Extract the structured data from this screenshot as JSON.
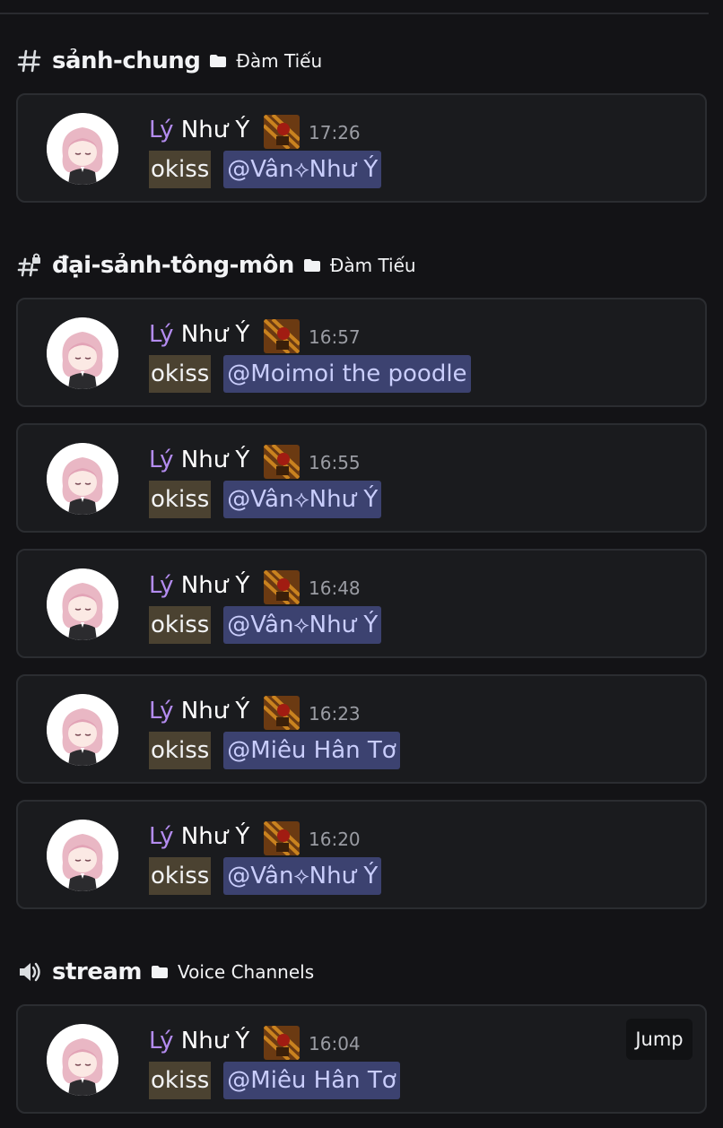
{
  "channels": {
    "sanh_chung": {
      "name": "sảnh-chung",
      "category": "Đàm Tiếu"
    },
    "dai_sanh": {
      "name": "đại-sảnh-tông-môn",
      "category": "Đàm Tiếu"
    },
    "stream": {
      "name": "stream",
      "category": "Voice Channels"
    }
  },
  "author": {
    "name_part1": "Lý",
    "name_part2": " Như Ý"
  },
  "messages": [
    {
      "time": "17:26",
      "text": "okiss",
      "mention": "@Vân⟡Như Ý"
    },
    {
      "time": "16:57",
      "text": "okiss",
      "mention": "@Moimoi the poodle"
    },
    {
      "time": "16:55",
      "text": "okiss",
      "mention": "@Vân⟡Như Ý"
    },
    {
      "time": "16:48",
      "text": "okiss",
      "mention": "@Vân⟡Như Ý"
    },
    {
      "time": "16:23",
      "text": "okiss",
      "mention": "@Miêu Hân Tơ"
    },
    {
      "time": "16:20",
      "text": "okiss",
      "mention": "@Vân⟡Như Ý"
    },
    {
      "time": "16:04",
      "text": "okiss",
      "mention": "@Miêu Hân Tơ"
    }
  ],
  "jump_label": "Jump",
  "colors": {
    "background": "#131316",
    "card": "#1a1b1e",
    "username_accent": "#b48cf0",
    "mention_bg": "#3c4270",
    "mention_text": "#c9cdfb",
    "highlight_bg": "#4b4231"
  },
  "icons": {
    "text_channel": "hash-icon",
    "locked_text_channel": "hash-lock-icon",
    "voice_channel": "speaker-icon",
    "category": "folder-icon"
  }
}
